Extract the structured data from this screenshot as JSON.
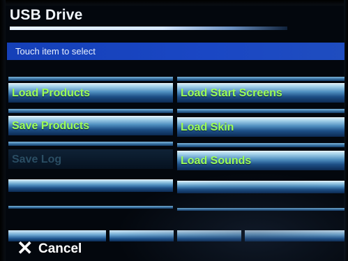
{
  "header": {
    "title": "USB Drive"
  },
  "prompt": {
    "text": "Touch item to select"
  },
  "buttons": {
    "load_products": "Load Products",
    "load_start_screens": "Load Start Screens",
    "save_products": "Save Products",
    "load_skin": "Load Skin",
    "save_log": "Save Log",
    "load_sounds": "Load Sounds"
  },
  "footer": {
    "cancel_label": "Cancel",
    "cancel_icon": "close-x-icon"
  },
  "colors": {
    "button_text": "#9cff5a",
    "prompt_bar": "#1a47c4"
  }
}
